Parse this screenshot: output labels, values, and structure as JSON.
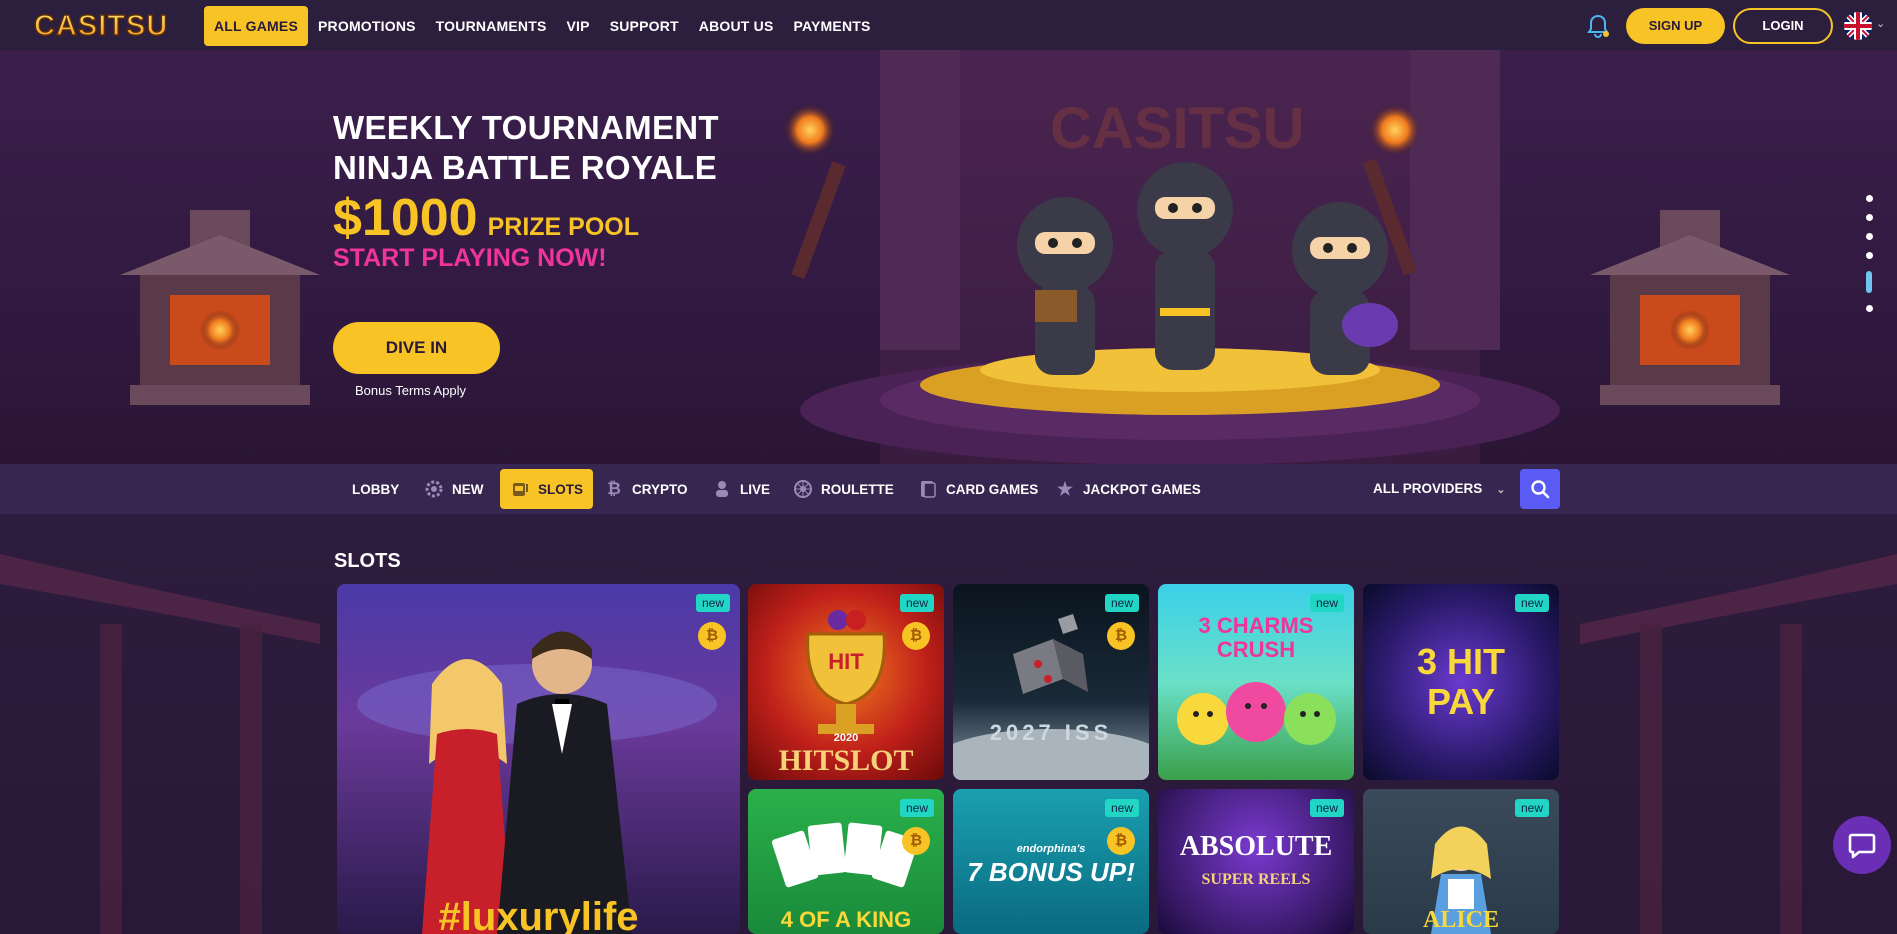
{
  "brand": {
    "logo_text": "CASITSU"
  },
  "topnav": {
    "items": [
      {
        "label": "ALL GAMES",
        "active": true
      },
      {
        "label": "PROMOTIONS"
      },
      {
        "label": "TOURNAMENTS"
      },
      {
        "label": "VIP"
      },
      {
        "label": "SUPPORT"
      },
      {
        "label": "ABOUT US"
      },
      {
        "label": "PAYMENTS"
      }
    ],
    "signup_label": "SIGN UP",
    "login_label": "LOGIN",
    "bell_icon": "bell-icon",
    "language_flag": "uk-flag-icon"
  },
  "hero": {
    "title_line1": "WEEKLY TOURNAMENT",
    "title_line2": "NINJA BATTLE ROYALE",
    "prize_amount": "$1000",
    "prize_label": "PRIZE POOL",
    "cta_text": "START PLAYING NOW!",
    "button_label": "DIVE IN",
    "terms": "Bonus Terms Apply",
    "banner_logo": "CASITSU",
    "slide_count": 6,
    "active_slide": 5
  },
  "categories": {
    "items": [
      {
        "label": "LOBBY",
        "icon": ""
      },
      {
        "label": "NEW",
        "icon": "gear-icon"
      },
      {
        "label": "SLOTS",
        "icon": "slot-machine-icon",
        "active": true
      },
      {
        "label": "CRYPTO",
        "icon": "bitcoin-icon"
      },
      {
        "label": "LIVE",
        "icon": "dealer-icon"
      },
      {
        "label": "ROULETTE",
        "icon": "roulette-icon"
      },
      {
        "label": "CARD GAMES",
        "icon": "cards-icon"
      },
      {
        "label": "JACKPOT GAMES",
        "icon": "star-icon"
      }
    ],
    "providers_label": "ALL PROVIDERS"
  },
  "slots": {
    "title": "SLOTS",
    "new_badge": "new",
    "btc_symbol": "₿",
    "games": [
      {
        "name": "#luxurylife",
        "featured": true
      },
      {
        "name": "HITSLOT",
        "sub": "2020"
      },
      {
        "name": "2027 ISS"
      },
      {
        "name": "3 CHARMS CRUSH"
      },
      {
        "name": "3 HIT PAY"
      },
      {
        "name": "4 OF A KING"
      },
      {
        "name": "7 BONUS UP!",
        "sub": "endorphina's"
      },
      {
        "name": "ABSOLUTE",
        "sub": "SUPER REELS"
      },
      {
        "name": "ALICE"
      }
    ]
  }
}
